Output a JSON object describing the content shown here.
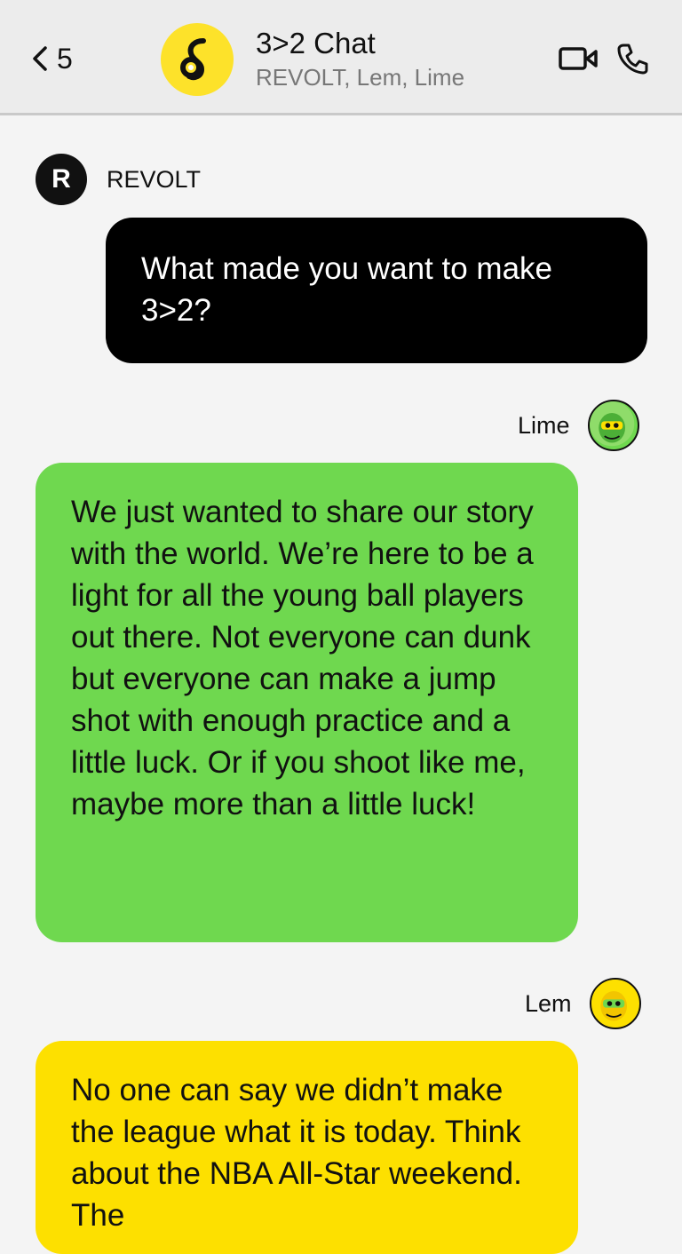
{
  "header": {
    "back_count": "5",
    "title": "3>2 Chat",
    "subtitle": "REVOLT, Lem, Lime"
  },
  "messages": [
    {
      "sender": "REVOLT",
      "avatar_letter": "R",
      "text": "What made you want to make 3>2?",
      "color": "#000000"
    },
    {
      "sender": "Lime",
      "text": "We just wanted to share our story with the world. We’re here to be a light for all the young ball players out there. Not everyone can dunk but everyone can make a jump shot with enough practice and a little luck. Or if you shoot like me, maybe more than a little luck!",
      "color": "#6fd84f"
    },
    {
      "sender": "Lem",
      "text": "No one can say we didn’t make the league what it is today. Think about the NBA All-Star weekend. The",
      "color": "#fde000"
    }
  ],
  "icons": {
    "back": "chevron-left-icon",
    "video": "video-camera-icon",
    "phone": "phone-icon"
  }
}
